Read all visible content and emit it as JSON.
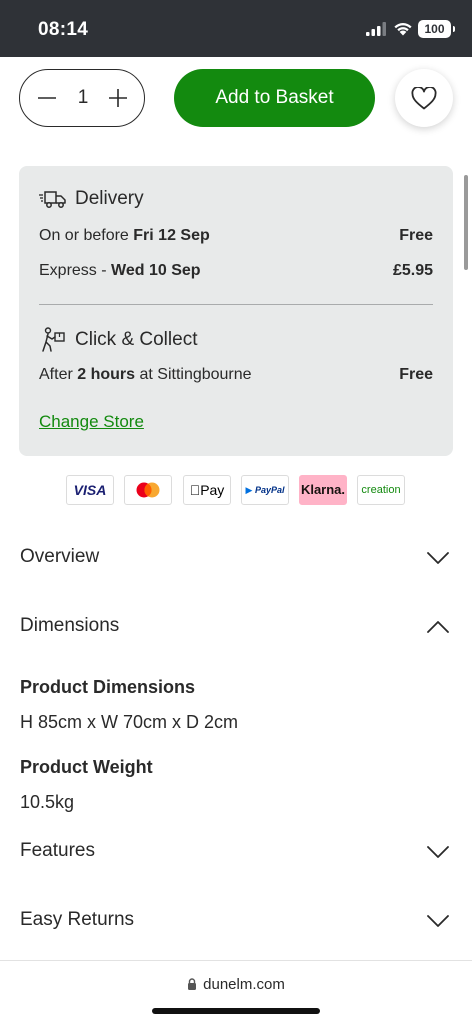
{
  "status_bar": {
    "time": "08:14",
    "battery": "100"
  },
  "purchase": {
    "quantity": "1",
    "add_to_basket": "Add to Basket"
  },
  "delivery": {
    "heading": "Delivery",
    "standard_prefix": "On or before ",
    "standard_date": "Fri 12 Sep",
    "standard_price": "Free",
    "express_prefix": "Express - ",
    "express_date": "Wed 10 Sep",
    "express_price": "£5.95"
  },
  "collect": {
    "heading": "Click & Collect",
    "prefix": "After ",
    "time": "2 hours",
    "suffix": " at Sittingbourne",
    "price": "Free",
    "change_store": "Change Store"
  },
  "payment_methods": {
    "visa": "VISA",
    "apple_pay": "Pay",
    "paypal": "PayPal",
    "klarna": "Klarna.",
    "creation": "creation"
  },
  "accordion": {
    "overview": "Overview",
    "dimensions": "Dimensions",
    "features": "Features",
    "easy_returns": "Easy Returns"
  },
  "dimensions": {
    "product_dimensions_title": "Product Dimensions",
    "product_dimensions_value": "H 85cm x W 70cm x D 2cm",
    "product_weight_title": "Product Weight",
    "product_weight_value": "10.5kg"
  },
  "browser": {
    "url": "dunelm.com"
  },
  "colors": {
    "brand_green": "#138a0f",
    "card_bg": "#e8eaea",
    "status_bar": "#2f3237"
  }
}
